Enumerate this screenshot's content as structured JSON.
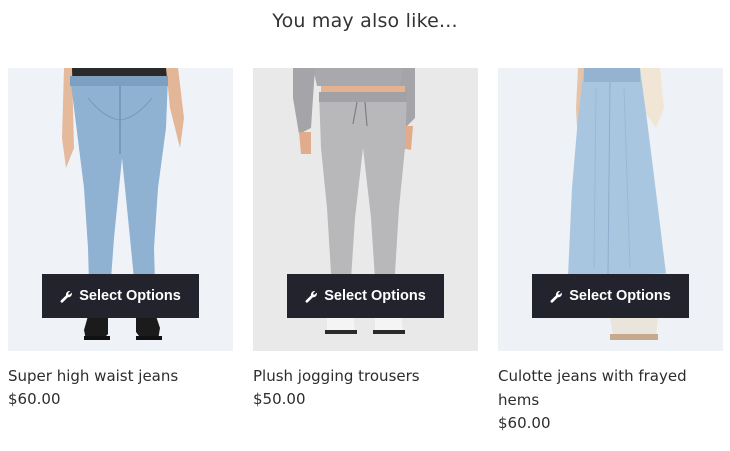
{
  "section": {
    "title": "You may also like..."
  },
  "products": [
    {
      "name": "Super high waist jeans",
      "price": "$60.00",
      "button_label": "Select Options",
      "image_bg": "#eff3f8"
    },
    {
      "name": "Plush jogging trousers",
      "price": "$50.00",
      "button_label": "Select Options",
      "image_bg": "#e9e9e9"
    },
    {
      "name": "Culotte jeans with frayed hems",
      "price": "$60.00",
      "button_label": "Select Options",
      "image_bg": "#eef1f6"
    }
  ],
  "colors": {
    "button_bg": "#23232e",
    "button_text": "#ffffff"
  },
  "icons": {
    "button_icon": "wrench-icon"
  }
}
